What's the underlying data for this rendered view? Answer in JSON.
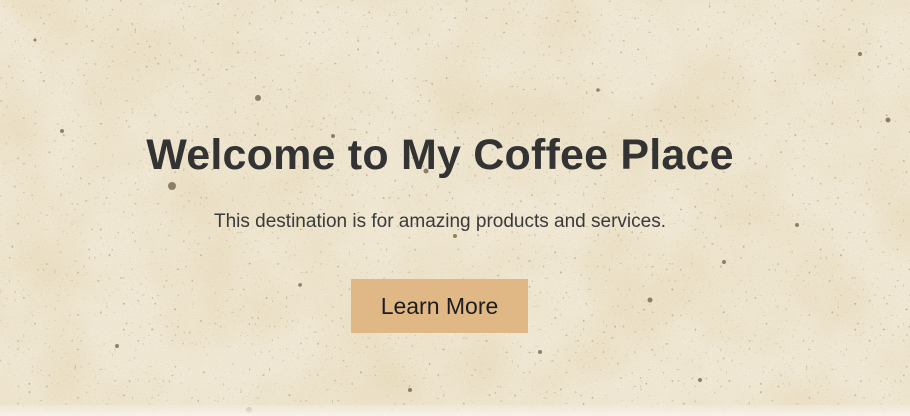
{
  "hero": {
    "title": "Welcome to My Coffee Place",
    "subtitle": "This destination is for amazing products and services.",
    "cta_label": "Learn More"
  },
  "colors": {
    "background": "#efe6d2",
    "text": "#333333",
    "button": "#dfb886"
  }
}
